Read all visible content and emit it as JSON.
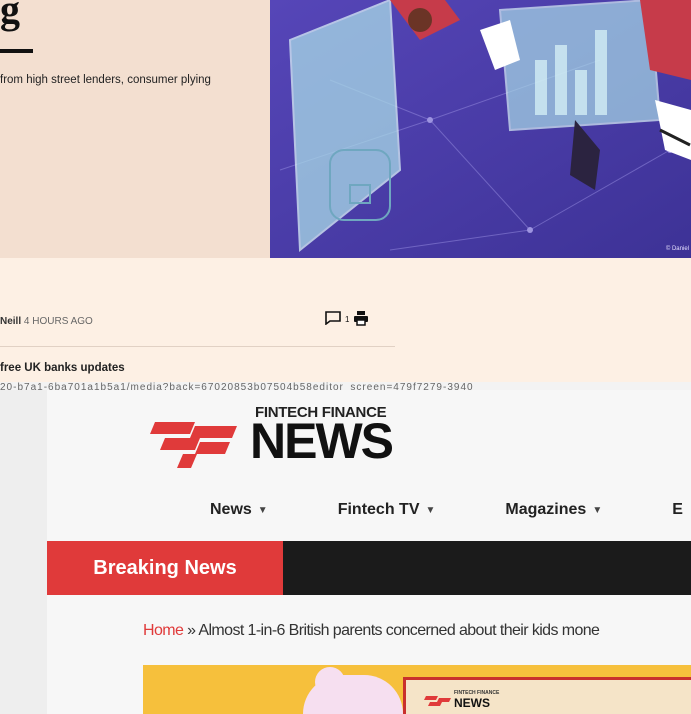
{
  "ft": {
    "headline_fragment": "g",
    "standfirst": "from high street lenders, consumer plying",
    "image_credit": "© Daniel",
    "byline_name": "Neill",
    "byline_time": "4 HOURS AGO",
    "comment_count": "1",
    "updates_label": "free UK banks updates",
    "url_fragment": "20-b7a1-6ba701a1b5a1/media?back=67020853b07504b58editor_screen=479f7279-3940"
  },
  "ffn": {
    "logo_top": "FINTECH FINANCE",
    "logo_main": "NEWS",
    "nav": [
      "News",
      "Fintech TV",
      "Magazines",
      "E"
    ],
    "breaking_label": "Breaking News",
    "breadcrumb_home": "Home",
    "breadcrumb_sep": " » ",
    "breadcrumb_current": "Almost 1-in-6 British parents concerned about their kids mone",
    "hero_logo_top": "FINTECH FINANCE",
    "hero_logo_main": "NEWS"
  },
  "colors": {
    "ffn_red": "#e03a3a",
    "ft_background": "#fdf0e4",
    "hero_yellow": "#f6c03c"
  }
}
